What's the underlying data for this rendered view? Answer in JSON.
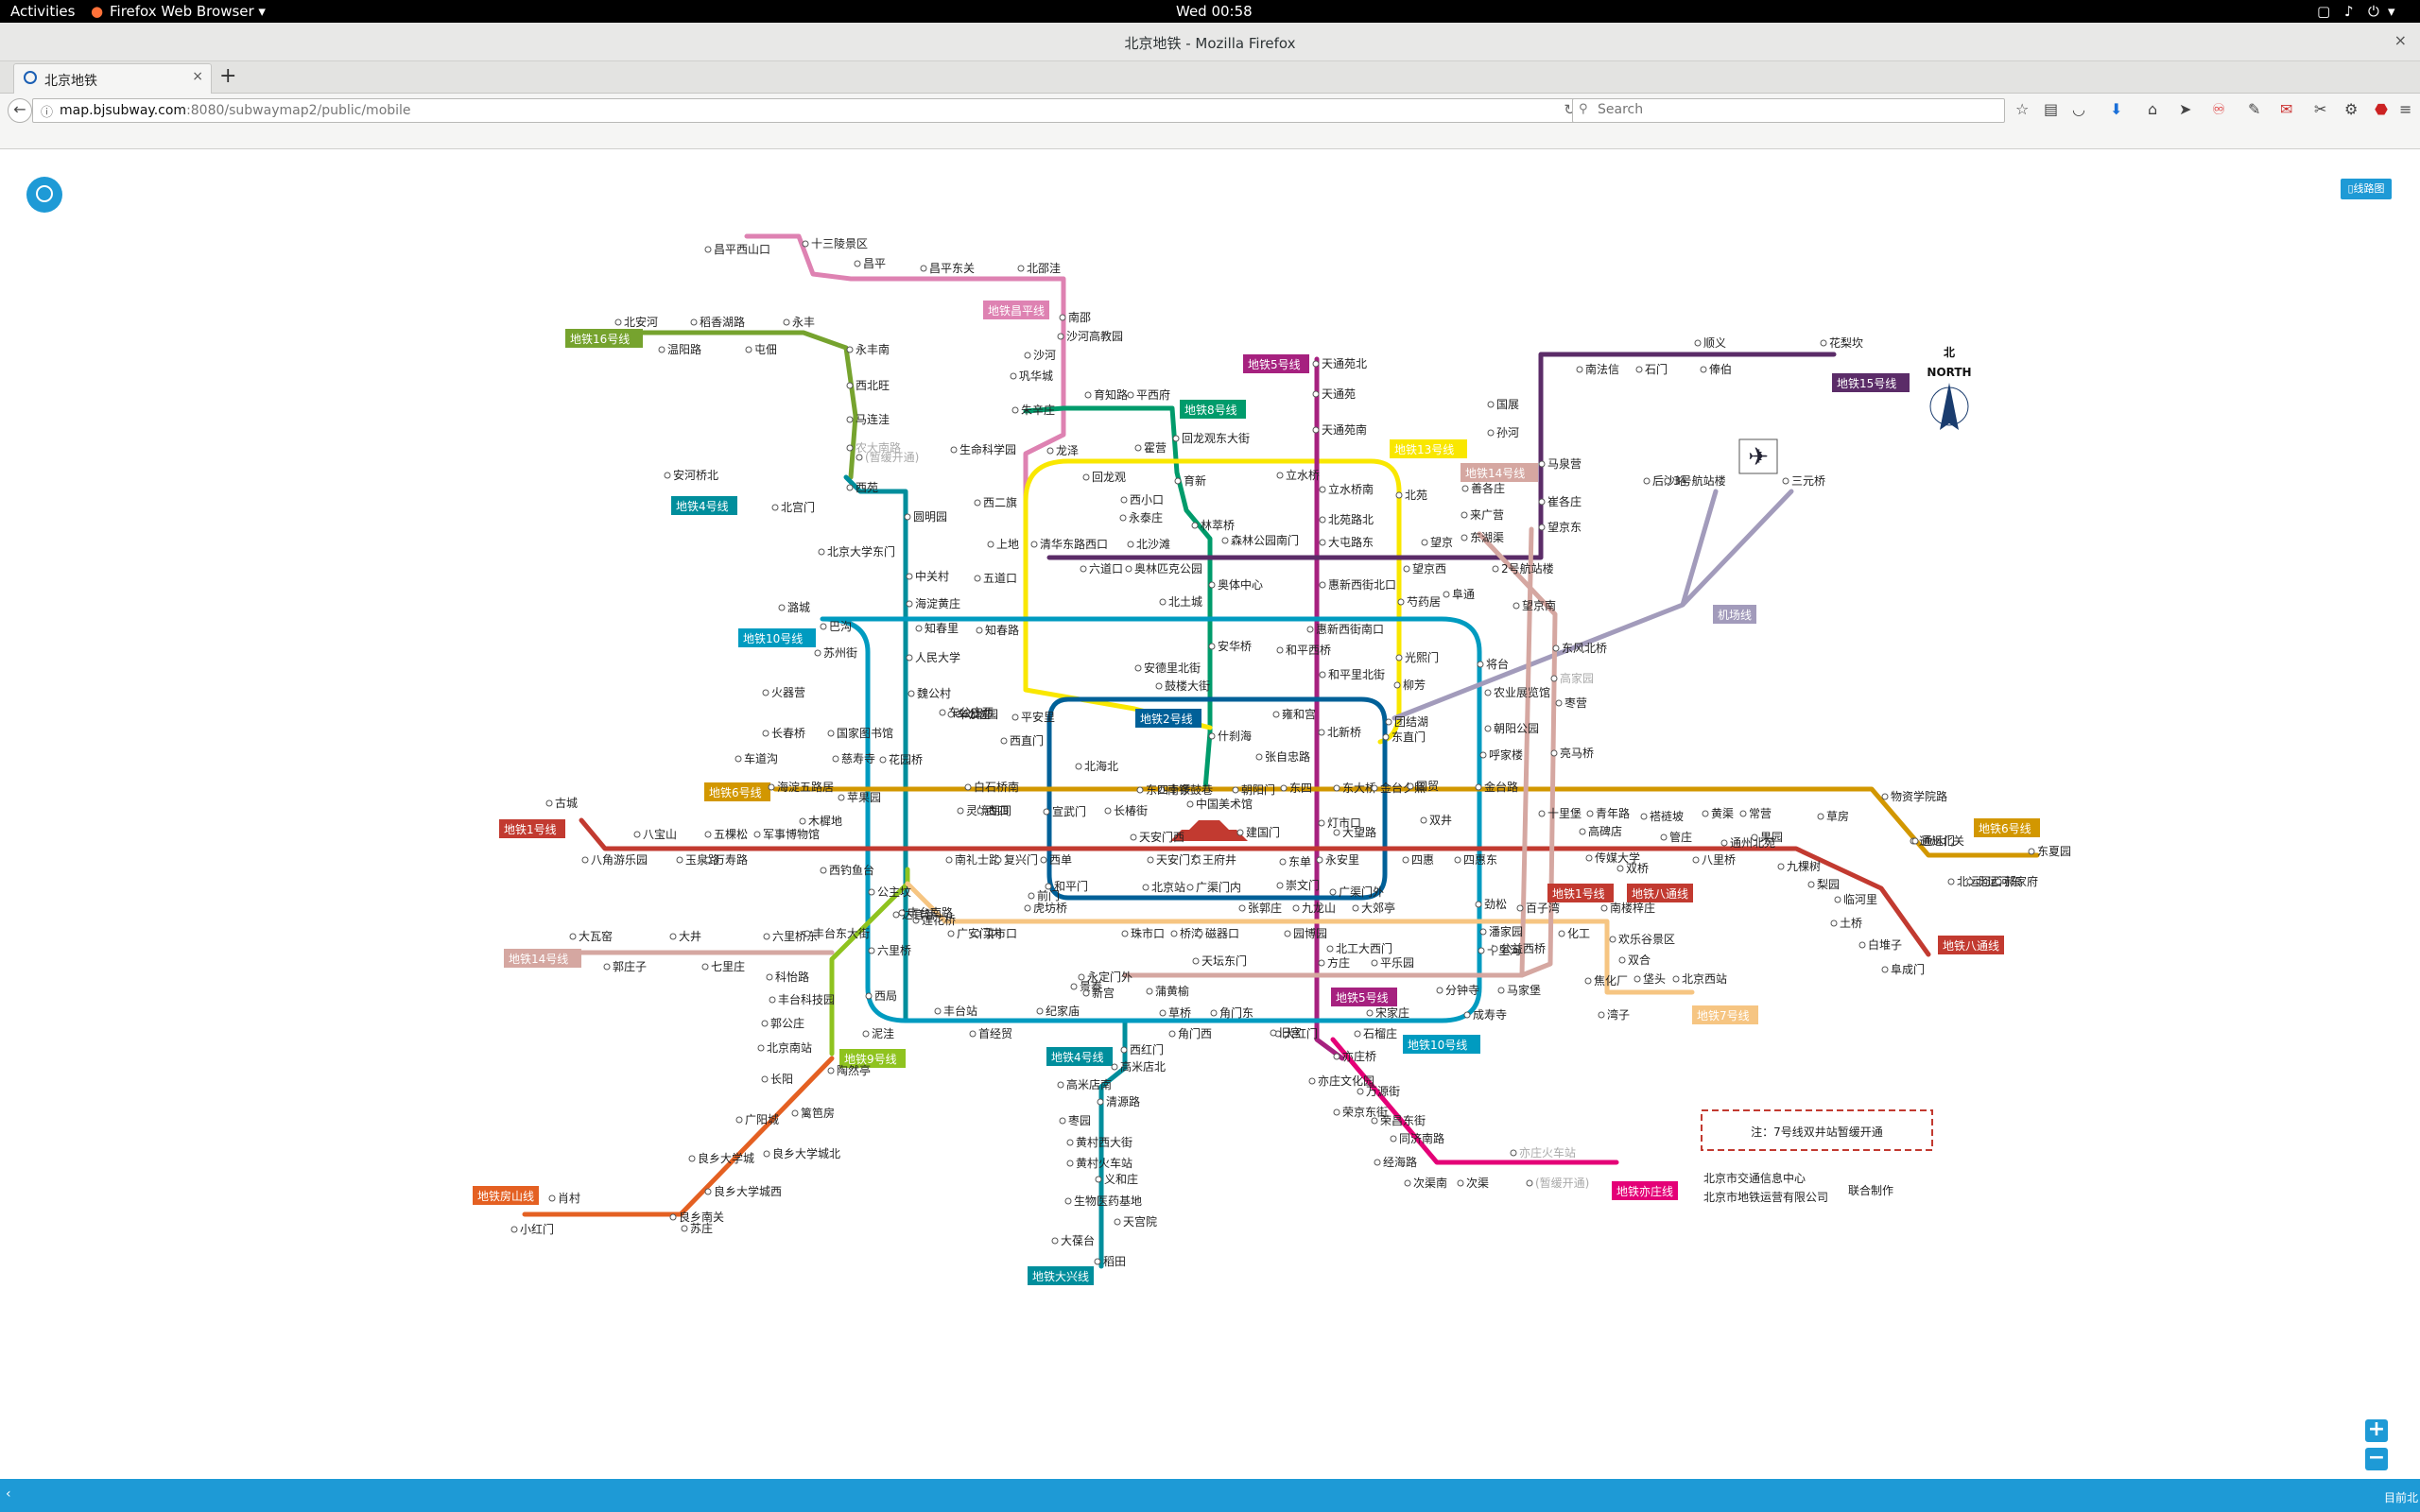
{
  "system": {
    "activities": "Activities",
    "app_menu": "Firefox Web Browser ▾",
    "clock": "Wed 00:58"
  },
  "window": {
    "title": "北京地铁 - Mozilla Firefox",
    "close": "×"
  },
  "tab": {
    "title": "北京地铁",
    "close": "×",
    "new_tab": "+"
  },
  "nav": {
    "url_host": "map.bjsubway.com",
    "url_rest": ":8080/subwaymap2/public/mobile",
    "url_prefix": "",
    "search_placeholder": "Search",
    "reload": "↻"
  },
  "page": {
    "tile_button": "▯线路图",
    "zoom_in": "+",
    "zoom_out": "−",
    "status_right": "目前北",
    "status_left": "‹"
  },
  "map": {
    "compass_cn": "北",
    "compass_en": "NORTH",
    "note": "注：7号线双井站暂缓开通",
    "credit1": "北京市交通信息中心",
    "credit2": "北京市地铁运营有限公司",
    "credit3": "联合制作",
    "colors": {
      "l1": "#c23a30",
      "l2": "#006098",
      "l4": "#008e9c",
      "l5": "#a6217f",
      "l6": "#d29700",
      "l7": "#f6c582",
      "l8": "#009b6b",
      "l9": "#8fc31f",
      "l10": "#009bc0",
      "l13": "#f9e700",
      "l14": "#d5a7a1",
      "l15": "#5b2c68",
      "l16": "#76a32e",
      "changping": "#de82b2",
      "fangshan": "#e46022",
      "yizhuang": "#e40077",
      "airport": "#a29bbb"
    },
    "badges": [
      {
        "id": "b16",
        "text": "地铁16号线"
      },
      {
        "id": "bcp",
        "text": "地铁昌平线"
      },
      {
        "id": "b5",
        "text": "地铁5号线"
      },
      {
        "id": "b8",
        "text": "地铁8号线"
      },
      {
        "id": "b13",
        "text": "地铁13号线"
      },
      {
        "id": "b14e",
        "text": "地铁14号线"
      },
      {
        "id": "b15",
        "text": "地铁15号线"
      },
      {
        "id": "b4",
        "text": "地铁4号线"
      },
      {
        "id": "b10",
        "text": "地铁10号线"
      },
      {
        "id": "bap",
        "text": "机场线"
      },
      {
        "id": "b2",
        "text": "地铁2号线"
      },
      {
        "id": "b6w",
        "text": "地铁6号线"
      },
      {
        "id": "b6e",
        "text": "地铁6号线"
      },
      {
        "id": "b1w",
        "text": "地铁1号线"
      },
      {
        "id": "b1e",
        "text": "地铁1号线"
      },
      {
        "id": "bbt",
        "text": "地铁八通线"
      },
      {
        "id": "bbt2",
        "text": "地铁八通线"
      },
      {
        "id": "b14w",
        "text": "地铁14号线"
      },
      {
        "id": "b7",
        "text": "地铁7号线"
      },
      {
        "id": "b9",
        "text": "地铁9号线"
      },
      {
        "id": "b5s",
        "text": "地铁5号线"
      },
      {
        "id": "b10s",
        "text": "地铁10号线"
      },
      {
        "id": "b4s",
        "text": "地铁4号线"
      },
      {
        "id": "bfs",
        "text": "地铁房山线"
      },
      {
        "id": "bdx",
        "text": "地铁大兴线"
      },
      {
        "id": "byz",
        "text": "地铁亦庄线"
      }
    ],
    "stations": [
      "昌平西山口",
      "十三陵景区",
      "昌平",
      "昌平东关",
      "北邵洼",
      "南邵",
      "沙河高教园",
      "沙河",
      "巩华城",
      "朱辛庄",
      "生命科学园",
      "西二旗",
      "北安河",
      "稻香湖路",
      "永丰",
      "温阳路",
      "屯佃",
      "永丰南",
      "西北旺",
      "马连洼",
      "农大南路",
      "(暂缓开通)",
      "西苑",
      "安河桥北",
      "北宫门",
      "圆明园",
      "北京大学东门",
      "中关村",
      "海淀黄庄",
      "知春里",
      "知春路",
      "人民大学",
      "魏公村",
      "国家图书馆",
      "动物园",
      "西直门",
      "育知路",
      "平西府",
      "回龙观东大街",
      "霍营",
      "龙泽",
      "回龙观",
      "育新",
      "西小口",
      "永泰庄",
      "林萃桥",
      "森林公园南门",
      "奥林匹克公园",
      "奥体中心",
      "北土城",
      "安华桥",
      "安德里北街",
      "鼓楼大街",
      "什刹海",
      "南锣鼓巷",
      "中国美术馆",
      "上地",
      "五道口",
      "清华东路西口",
      "六道口",
      "北沙滩",
      "天通苑北",
      "天通苑",
      "天通苑南",
      "立水桥",
      "立水桥南",
      "北苑路北",
      "大屯路东",
      "惠新西街北口",
      "惠新西街南口",
      "和平西桥",
      "和平里北街",
      "雍和宫",
      "北新桥",
      "张自忠路",
      "东四",
      "灯市口",
      "东单",
      "崇文门",
      "北苑",
      "望京西",
      "芍药居",
      "光熙门",
      "柳芳",
      "东直门",
      "善各庄",
      "来广营",
      "东湖渠",
      "望京",
      "阜通",
      "望京南",
      "后沙峪",
      "南法信",
      "石门",
      "顺义",
      "俸伯",
      "花梨坎",
      "国展",
      "孙河",
      "马泉营",
      "崔各庄",
      "望京东",
      "2号航站楼",
      "3号航站楼",
      "三元桥",
      "将台",
      "高家园",
      "东风北桥",
      "枣营",
      "朝阳公园",
      "亮马桥",
      "农业展览馆",
      "团结湖",
      "呼家楼",
      "金台路",
      "十里堡",
      "青年路",
      "褡裢坡",
      "黄渠",
      "常营",
      "草房",
      "物资学院路",
      "通州北关",
      "通运门",
      "北运河西",
      "北运河东",
      "郝家府",
      "东夏园",
      "潞城",
      "巴沟",
      "苏州街",
      "火器营",
      "长春桥",
      "车道沟",
      "海淀五路居",
      "慈寿寺",
      "花园桥",
      "白石桥南",
      "车公庄西",
      "车公庄",
      "平安里",
      "北海北",
      "东四十条",
      "朝阳门",
      "东大桥",
      "金台夕照",
      "国贸",
      "双井",
      "劲松",
      "潘家园",
      "十里河",
      "分钟寺",
      "成寿寺",
      "宋家庄",
      "石榴庄",
      "大红门",
      "角门东",
      "角门西",
      "草桥",
      "纪家庙",
      "首经贸",
      "丰台站",
      "泥洼",
      "西局",
      "六里桥",
      "莲花桥",
      "公主坟",
      "西钓鱼台",
      "苹果园",
      "古城",
      "八角游乐园",
      "八宝山",
      "玉泉路",
      "五棵松",
      "万寿路",
      "军事博物馆",
      "木樨地",
      "南礼士路",
      "复兴门",
      "西单",
      "天安门西",
      "天安门东",
      "王府井",
      "建国门",
      "永安里",
      "大望路",
      "四惠",
      "四惠东",
      "高碑店",
      "传媒大学",
      "双桥",
      "管庄",
      "八里桥",
      "通州北苑",
      "果园",
      "九棵树",
      "梨园",
      "临河里",
      "土桥",
      "白堆子",
      "阜成门",
      "灵境胡同",
      "西四",
      "宣武门",
      "长椿街",
      "和平门",
      "前门",
      "北京站",
      "广渠门内",
      "广渠门外",
      "九龙山",
      "大郊亭",
      "百子湾",
      "化工",
      "南楼梓庄",
      "欢乐谷景区",
      "双合",
      "焦化厂",
      "垡头",
      "北京西站",
      "湾子",
      "达官营",
      "广安门内",
      "菜市口",
      "虎坊桥",
      "珠市口",
      "桥湾",
      "磁器口",
      "张郭庄",
      "园博园",
      "大瓦窑",
      "郭庄子",
      "大井",
      "七里庄",
      "六里桥东",
      "丰台东大街",
      "丰台南路",
      "科怡路",
      "丰台科技园",
      "郭公庄",
      "北京南站",
      "陶然亭",
      "永定门外",
      "景泰",
      "蒲黄榆",
      "天坛东门",
      "方庄",
      "北工大西门",
      "平乐园",
      "马家堡",
      "公益西桥",
      "新宫",
      "西红门",
      "高米店北",
      "高米店南",
      "枣园",
      "清源路",
      "黄村西大街",
      "黄村火车站",
      "义和庄",
      "生物医药基地",
      "天宫院",
      "大葆台",
      "稻田",
      "长阳",
      "篱笆房",
      "广阳城",
      "良乡大学城北",
      "良乡大学城",
      "良乡大学城西",
      "良乡南关",
      "苏庄",
      "肖村",
      "小红门",
      "旧宫",
      "亦庄桥",
      "亦庄文化园",
      "万源街",
      "荣京东街",
      "荣昌东街",
      "同济南路",
      "经海路",
      "次渠南",
      "次渠",
      "亦庄火车站",
      "(暂缓开通)"
    ]
  }
}
